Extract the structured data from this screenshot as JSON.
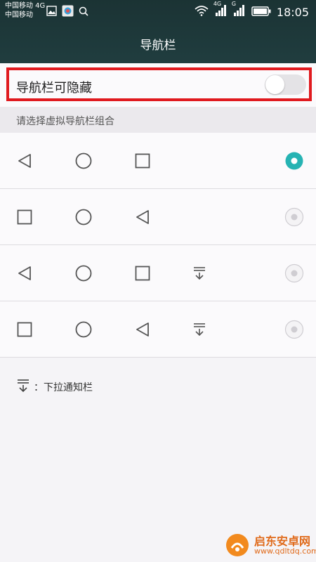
{
  "status_bar": {
    "carrier_line1": "中国移动 4G",
    "carrier_line2": "中国移动",
    "network_tags": [
      "4G",
      "G"
    ],
    "time": "18:05",
    "icons": [
      "gallery-icon",
      "app-icon",
      "search-icon",
      "wifi-icon",
      "signal-icon",
      "signal-icon",
      "battery-icon"
    ]
  },
  "action_bar": {
    "title": "导航栏"
  },
  "toggle_row": {
    "label": "导航栏可隐藏",
    "enabled": false,
    "highlighted": true
  },
  "section": {
    "label": "请选择虚拟导航栏组合"
  },
  "options": [
    {
      "icons": [
        "back-icon",
        "home-icon",
        "recent-icon"
      ],
      "selected": true
    },
    {
      "icons": [
        "recent-icon",
        "home-icon",
        "back-icon"
      ],
      "selected": false
    },
    {
      "icons": [
        "back-icon",
        "home-icon",
        "recent-icon",
        "pull-down-notification-icon"
      ],
      "selected": false
    },
    {
      "icons": [
        "recent-icon",
        "home-icon",
        "back-icon",
        "pull-down-notification-icon"
      ],
      "selected": false
    }
  ],
  "legend": {
    "icon": "pull-down-notification-icon",
    "text": "：下拉通知栏"
  },
  "watermark": {
    "brand": "启东安卓网",
    "url": "www.qdltdq.com"
  },
  "colors": {
    "accent": "#26b3b3",
    "highlight": "#e01a1f",
    "header": "#1f3a3b"
  }
}
